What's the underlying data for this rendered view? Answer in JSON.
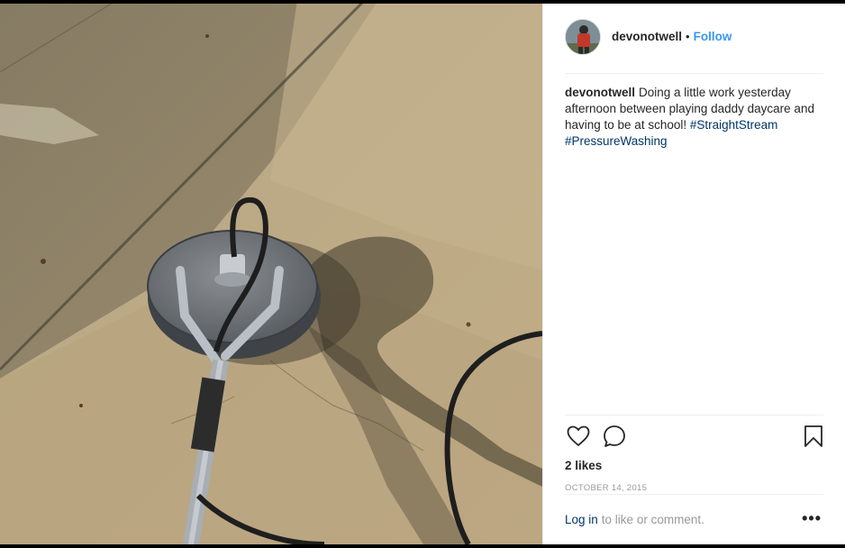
{
  "post": {
    "username": "devonotwell",
    "separator": "•",
    "follow_label": "Follow",
    "caption_user": "devonotwell",
    "caption_text": "Doing a little work yesterday afternoon between playing daddy daycare and having to be at school!",
    "hashtags": [
      "#StraightStream",
      "#PressureWashing"
    ],
    "likes": "2 likes",
    "date": "OCTOBER 14, 2015",
    "login_label": "Log in",
    "login_suffix": "to like or comment.",
    "more_label": "•••"
  },
  "icons": {
    "like": "heart-icon",
    "comment": "comment-icon",
    "save": "bookmark-icon",
    "options": "more-options-icon"
  },
  "colors": {
    "accent": "#3897f0",
    "link": "#003569",
    "text": "#262626",
    "muted": "#999999",
    "divider": "#efefef"
  }
}
